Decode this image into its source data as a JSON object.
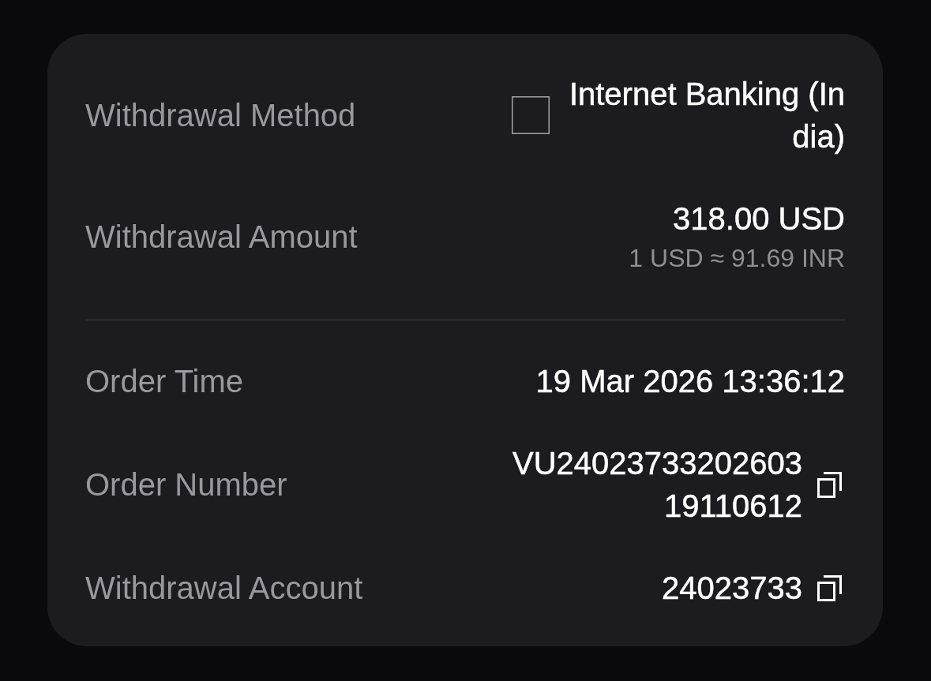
{
  "sections": [
    {
      "rows": [
        {
          "kind": "method",
          "label": "Withdrawal Method",
          "value": "Internet Banking (India)"
        },
        {
          "kind": "amount",
          "label": "Withdrawal Amount",
          "value": "318.00 USD",
          "note": "1 USD ≈ 91.69 INR"
        }
      ]
    },
    {
      "rows": [
        {
          "kind": "plain",
          "label": "Order Time",
          "value": "19 Mar 2026 13:36:12"
        },
        {
          "kind": "copy",
          "label": "Order Number",
          "value": "VU2402373320260319110612"
        },
        {
          "kind": "copy",
          "label": "Withdrawal Account",
          "value": "24023733"
        }
      ]
    }
  ]
}
